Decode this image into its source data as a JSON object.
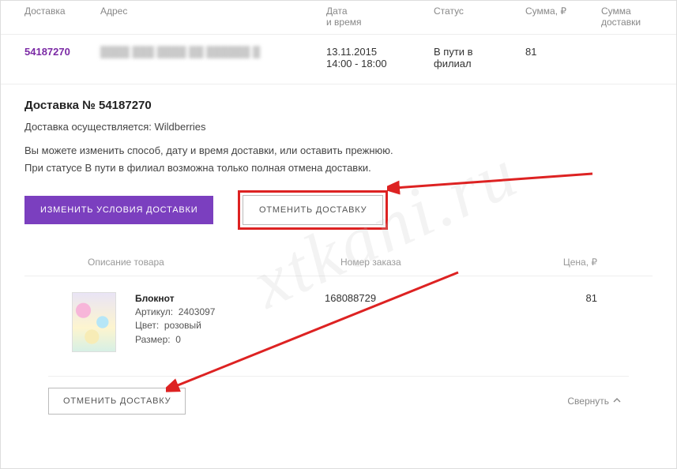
{
  "table_headers": {
    "delivery": "Доставка",
    "address": "Адрес",
    "datetime": "Дата\nи время",
    "status": "Статус",
    "sum": "Сумма, ₽",
    "sum_delivery": "Сумма\nдоставки"
  },
  "delivery_row": {
    "id": "54187270",
    "date": "13.11.2015",
    "time": "14:00 - 18:00",
    "status": "В пути в\nфилиал",
    "sum": "81"
  },
  "detail": {
    "title": "Доставка № 54187270",
    "carrier_line": "Доставка осуществляется: Wildberries",
    "line1": "Вы можете изменить способ, дату и время доставки, или оставить прежнюю.",
    "line2": "При статусе В пути в филиал возможна только полная отмена доставки."
  },
  "buttons": {
    "change": "ИЗМЕНИТЬ УСЛОВИЯ ДОСТАВКИ",
    "cancel": "ОТМЕНИТЬ ДОСТАВКУ",
    "cancel_footer": "ОТМЕНИТЬ ДОСТАВКУ"
  },
  "item_headers": {
    "desc": "Описание товара",
    "order": "Номер заказа",
    "price": "Цена, ₽"
  },
  "item": {
    "name": "Блокнот",
    "article_label": "Артикул:",
    "article_val": "2403097",
    "color_label": "Цвет:",
    "color_val": "розовый",
    "size_label": "Размер:",
    "size_val": "0",
    "order": "168088729",
    "price": "81"
  },
  "collapse": "Свернуть",
  "watermark": "xtkani.ru"
}
